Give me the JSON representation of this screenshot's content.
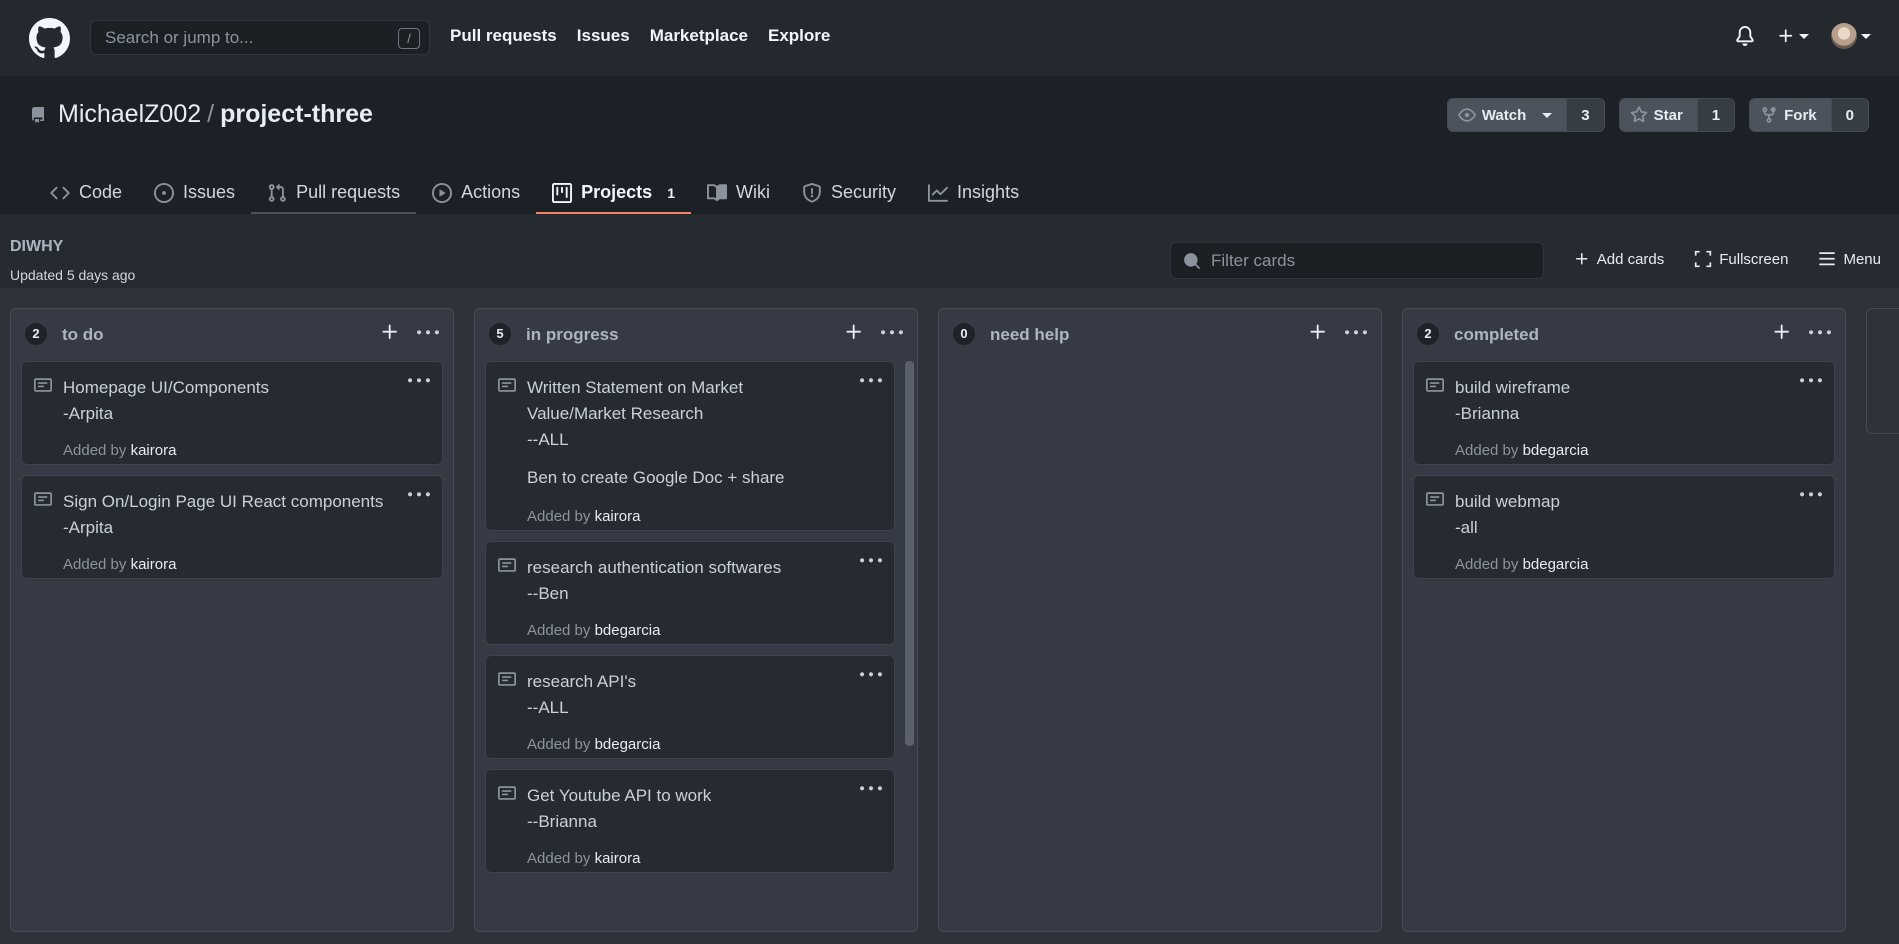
{
  "header": {
    "search_placeholder": "Search or jump to...",
    "slash": "/",
    "nav": [
      "Pull requests",
      "Issues",
      "Marketplace",
      "Explore"
    ]
  },
  "repo": {
    "owner": "MichaelZ002",
    "separator": "/",
    "name": "project-three",
    "watch_label": "Watch",
    "watch_count": "3",
    "star_label": "Star",
    "star_count": "1",
    "fork_label": "Fork",
    "fork_count": "0"
  },
  "tabs": {
    "code": "Code",
    "issues": "Issues",
    "pull_requests": "Pull requests",
    "actions": "Actions",
    "projects": "Projects",
    "projects_count": "1",
    "wiki": "Wiki",
    "security": "Security",
    "insights": "Insights"
  },
  "project": {
    "name": "DIWHY",
    "updated": "Updated 5 days ago",
    "filter_placeholder": "Filter cards",
    "add_cards": "Add cards",
    "fullscreen": "Fullscreen",
    "menu": "Menu"
  },
  "columns": [
    {
      "count": "2",
      "title": "to do",
      "cards": [
        {
          "text": "Homepage UI/Components\n-Arpita",
          "added_prefix": "Added by",
          "author": "kairora"
        },
        {
          "text": "Sign On/Login Page UI React components\n-Arpita",
          "added_prefix": "Added by",
          "author": "kairora"
        }
      ]
    },
    {
      "count": "5",
      "title": "in progress",
      "cards": [
        {
          "text": "Written Statement on Market\nValue/Market Research\n--ALL",
          "extra": "Ben to create Google Doc + share",
          "added_prefix": "Added by",
          "author": "kairora"
        },
        {
          "text": "research authentication softwares\n--Ben",
          "added_prefix": "Added by",
          "author": "bdegarcia"
        },
        {
          "text": "research API's\n--ALL",
          "added_prefix": "Added by",
          "author": "bdegarcia"
        },
        {
          "text": "Get Youtube API to work\n--Brianna",
          "added_prefix": "Added by",
          "author": "kairora"
        }
      ]
    },
    {
      "count": "0",
      "title": "need help",
      "cards": []
    },
    {
      "count": "2",
      "title": "completed",
      "cards": [
        {
          "text": "build wireframe\n-Brianna",
          "added_prefix": "Added by",
          "author": "bdegarcia"
        },
        {
          "text": "build webmap\n-all",
          "added_prefix": "Added by",
          "author": "bdegarcia"
        }
      ]
    }
  ]
}
